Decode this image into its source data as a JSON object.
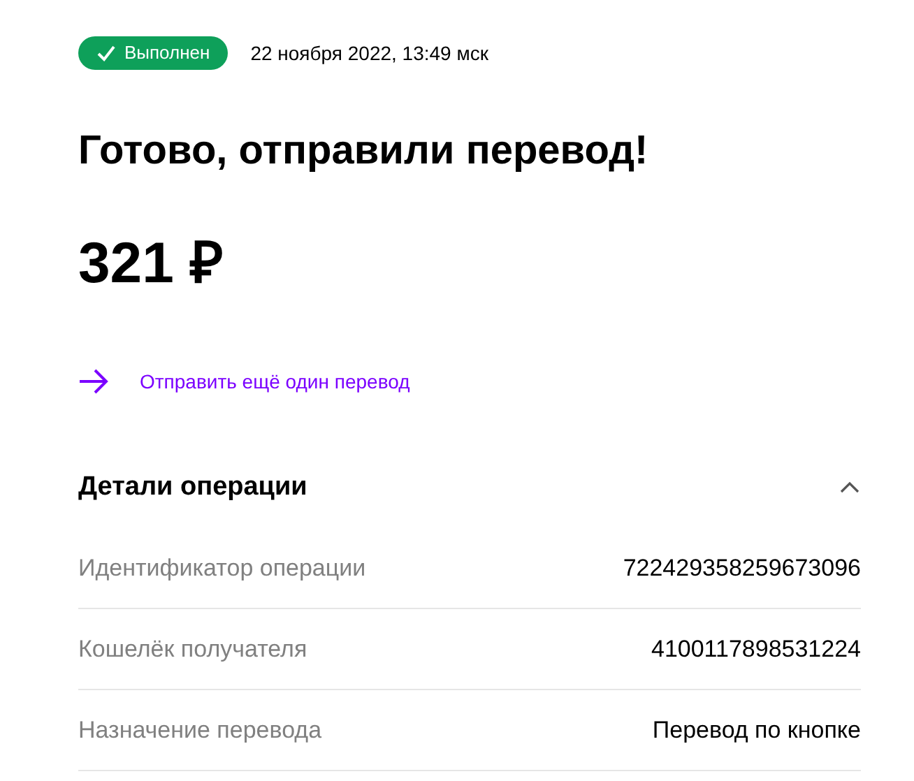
{
  "status": {
    "label": "Выполнен",
    "date": "22 ноября 2022, 13:49 мск"
  },
  "title": "Готово, отправили перевод!",
  "amount": "321 ₽",
  "action": {
    "label": "Отправить ещё один перевод"
  },
  "details": {
    "title": "Детали операции",
    "expanded": true,
    "rows": [
      {
        "label": "Идентификатор операции",
        "value": "722429358259673096"
      },
      {
        "label": "Кошелёк получателя",
        "value": "4100117898531224"
      },
      {
        "label": "Назначение перевода",
        "value": "Перевод по кнопке"
      }
    ]
  }
}
